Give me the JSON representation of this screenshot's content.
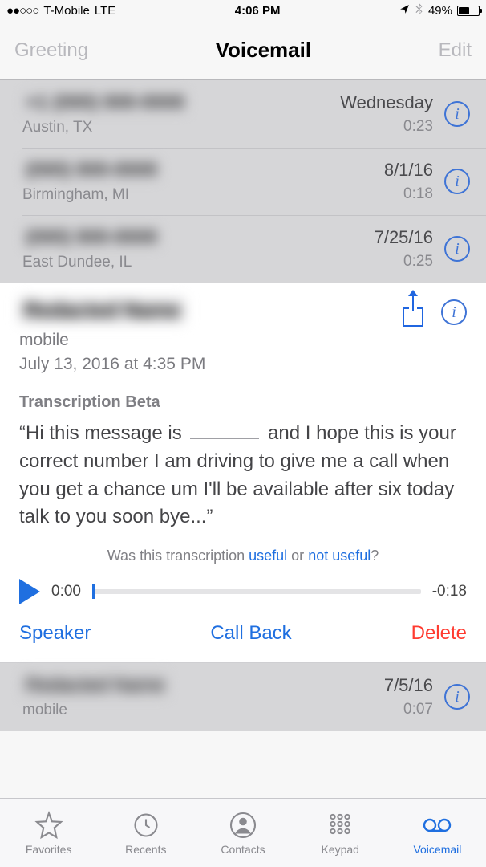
{
  "status": {
    "signal_dots": "●●○○○",
    "carrier": "T-Mobile",
    "network": "LTE",
    "time": "4:06 PM",
    "location_arrow": "➤",
    "bluetooth": "✱",
    "battery_pct": "49%"
  },
  "header": {
    "left": "Greeting",
    "title": "Voicemail",
    "right": "Edit"
  },
  "voicemails": [
    {
      "number": "+1 (000) 000-0000",
      "location": "Austin, TX",
      "date": "Wednesday",
      "duration": "0:23"
    },
    {
      "number": "(000) 000-0000",
      "location": "Birmingham, MI",
      "date": "8/1/16",
      "duration": "0:18"
    },
    {
      "number": "(000) 000-0000",
      "location": "East Dundee, IL",
      "date": "7/25/16",
      "duration": "0:25"
    }
  ],
  "detail": {
    "name": "Redacted Name",
    "label": "mobile",
    "datetime": "July 13, 2016 at 4:35 PM",
    "transcription_header": "Transcription Beta",
    "transcription_prefix": "“Hi this message is ",
    "transcription_suffix": " and I hope this is your correct number I am driving to give me a call when you get a chance um I'll be available after six today talk to you soon bye...”",
    "feedback_prefix": "Was this transcription ",
    "feedback_useful": "useful",
    "feedback_or": " or ",
    "feedback_not_useful": "not useful",
    "feedback_q": "?",
    "elapsed": "0:00",
    "remaining": "-0:18",
    "speaker": "Speaker",
    "callback": "Call Back",
    "delete": "Delete"
  },
  "voicemails_after": [
    {
      "number": "Redacted Name",
      "location": "mobile",
      "date": "7/5/16",
      "duration": "0:07"
    }
  ],
  "tabs": {
    "favorites": "Favorites",
    "recents": "Recents",
    "contacts": "Contacts",
    "keypad": "Keypad",
    "voicemail": "Voicemail"
  }
}
